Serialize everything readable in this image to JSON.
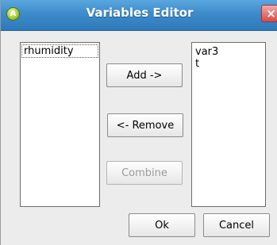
{
  "window": {
    "title": "Variables Editor",
    "app_icon_glyph": "A",
    "close_glyph": "×"
  },
  "available_list": {
    "items": [
      {
        "label": "rhumidity",
        "selected": true
      }
    ]
  },
  "selected_list": {
    "items": [
      {
        "label": "var3"
      },
      {
        "label": "t"
      }
    ]
  },
  "buttons": {
    "add_label": "Add ->",
    "remove_label": "<- Remove",
    "combine_label": "Combine",
    "ok_label": "Ok",
    "cancel_label": "Cancel"
  },
  "icons": {
    "app": "app-logo-icon",
    "close": "close-icon"
  },
  "colors": {
    "titlebar": "#3d8bcb",
    "close_button": "#d94a4a",
    "window_bg": "#ececec"
  }
}
